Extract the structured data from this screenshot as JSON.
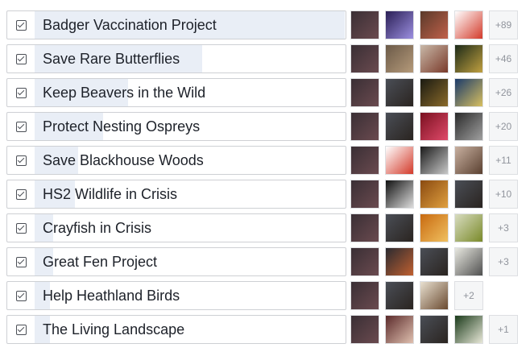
{
  "poll": {
    "options": [
      {
        "label": "Badger Vaccination Project",
        "vote_fraction": 1.0,
        "more_count": "+89",
        "avatars": [
          {
            "name": "user-avatar",
            "colors": [
              "#3a2f35",
              "#6a4a4f"
            ]
          },
          {
            "name": "purple-light-avatar",
            "colors": [
              "#2a1f55",
              "#9c8fe0"
            ]
          },
          {
            "name": "group-photo-avatar",
            "colors": [
              "#5a3a2a",
              "#c0604a"
            ]
          },
          {
            "name": "badger-logo-avatar",
            "colors": [
              "#ffffff",
              "#d33a2a"
            ]
          }
        ]
      },
      {
        "label": "Save Rare Butterflies",
        "vote_fraction": 0.54,
        "more_count": "+46",
        "avatars": [
          {
            "name": "user-avatar",
            "colors": [
              "#3a2f35",
              "#6a4a4f"
            ]
          },
          {
            "name": "portrait-avatar",
            "colors": [
              "#6b5a48",
              "#b59a7a"
            ]
          },
          {
            "name": "curly-hair-avatar",
            "colors": [
              "#c8b8a8",
              "#7a3a2a"
            ]
          },
          {
            "name": "book-cover-avatar",
            "colors": [
              "#1c2a18",
              "#c0a040"
            ]
          }
        ]
      },
      {
        "label": "Keep Beavers in the Wild",
        "vote_fraction": 0.3,
        "more_count": "+26",
        "avatars": [
          {
            "name": "user-avatar",
            "colors": [
              "#3a2f35",
              "#6a4a4f"
            ]
          },
          {
            "name": "bearded-man-avatar",
            "colors": [
              "#4a4e56",
              "#2a2420"
            ]
          },
          {
            "name": "bird-avatar",
            "colors": [
              "#1a1a12",
              "#8a6a2a"
            ]
          },
          {
            "name": "wave-art-avatar",
            "colors": [
              "#1a3a6a",
              "#d8c060"
            ]
          }
        ]
      },
      {
        "label": "Protect Nesting Ospreys",
        "vote_fraction": 0.22,
        "more_count": "+20",
        "avatars": [
          {
            "name": "user-avatar",
            "colors": [
              "#3a2f35",
              "#6a4a4f"
            ]
          },
          {
            "name": "bearded-man-avatar",
            "colors": [
              "#4a4e56",
              "#2a2420"
            ]
          },
          {
            "name": "red-light-avatar",
            "colors": [
              "#7a1020",
              "#e04a6a"
            ]
          },
          {
            "name": "mono-texture-avatar",
            "colors": [
              "#2a2a2a",
              "#a0a0a0"
            ]
          }
        ]
      },
      {
        "label": "Save Blackhouse Woods",
        "vote_fraction": 0.14,
        "more_count": "+11",
        "avatars": [
          {
            "name": "user-avatar",
            "colors": [
              "#3a2f35",
              "#6a4a4f"
            ]
          },
          {
            "name": "badger-logo-avatar",
            "colors": [
              "#ffffff",
              "#d33a2a"
            ]
          },
          {
            "name": "mono-photo-avatar",
            "colors": [
              "#1a1a1a",
              "#c8c8c8"
            ]
          },
          {
            "name": "selfie-avatar",
            "colors": [
              "#c8b0a0",
              "#5a4030"
            ]
          }
        ]
      },
      {
        "label": "HS2 Wildlife in Crisis",
        "vote_fraction": 0.13,
        "more_count": "+10",
        "avatars": [
          {
            "name": "user-avatar",
            "colors": [
              "#3a2f35",
              "#6a4a4f"
            ]
          },
          {
            "name": "mono-drawing-avatar",
            "colors": [
              "#111111",
              "#dddddd"
            ]
          },
          {
            "name": "orange-mask-avatar",
            "colors": [
              "#8a4a10",
              "#e0a040"
            ]
          },
          {
            "name": "bearded-man-avatar",
            "colors": [
              "#4a4e56",
              "#2a2420"
            ]
          }
        ]
      },
      {
        "label": "Crayfish in Crisis",
        "vote_fraction": 0.06,
        "more_count": "+3",
        "avatars": [
          {
            "name": "user-avatar",
            "colors": [
              "#3a2f35",
              "#6a4a4f"
            ]
          },
          {
            "name": "bearded-man-avatar",
            "colors": [
              "#4a4e56",
              "#2a2420"
            ]
          },
          {
            "name": "orange-light-avatar",
            "colors": [
              "#c86a10",
              "#f0c060"
            ]
          },
          {
            "name": "green-blob-avatar",
            "colors": [
              "#d8dcc0",
              "#7a8a2a"
            ]
          }
        ]
      },
      {
        "label": "Great Fen Project",
        "vote_fraction": 0.06,
        "more_count": "+3",
        "avatars": [
          {
            "name": "user-avatar",
            "colors": [
              "#3a2f35",
              "#6a4a4f"
            ]
          },
          {
            "name": "group-photo-avatar",
            "colors": [
              "#2a2a30",
              "#c06030"
            ]
          },
          {
            "name": "bearded-man-avatar",
            "colors": [
              "#4a4e56",
              "#2a2420"
            ]
          },
          {
            "name": "dull-sign-avatar",
            "colors": [
              "#e8e8e0",
              "#505050"
            ]
          }
        ]
      },
      {
        "label": "Help Heathland Birds",
        "vote_fraction": 0.05,
        "more_count": "+2",
        "avatars": [
          {
            "name": "user-avatar",
            "colors": [
              "#3a2f35",
              "#6a4a4f"
            ]
          },
          {
            "name": "bearded-man-avatar",
            "colors": [
              "#4a4e56",
              "#2a2420"
            ]
          },
          {
            "name": "tree-roots-avatar",
            "colors": [
              "#e8e0d0",
              "#6a4a30"
            ]
          }
        ]
      },
      {
        "label": "The Living Landscape",
        "vote_fraction": 0.05,
        "more_count": "+1",
        "avatars": [
          {
            "name": "user-avatar",
            "colors": [
              "#3a2f35",
              "#6a4a4f"
            ]
          },
          {
            "name": "group-photo-avatar",
            "colors": [
              "#5a2a2a",
              "#e0c0b0"
            ]
          },
          {
            "name": "bearded-man-avatar",
            "colors": [
              "#4a4e56",
              "#2a2420"
            ]
          },
          {
            "name": "forest-avatar",
            "colors": [
              "#1a3a1a",
              "#e8e8d8"
            ]
          }
        ]
      }
    ]
  }
}
